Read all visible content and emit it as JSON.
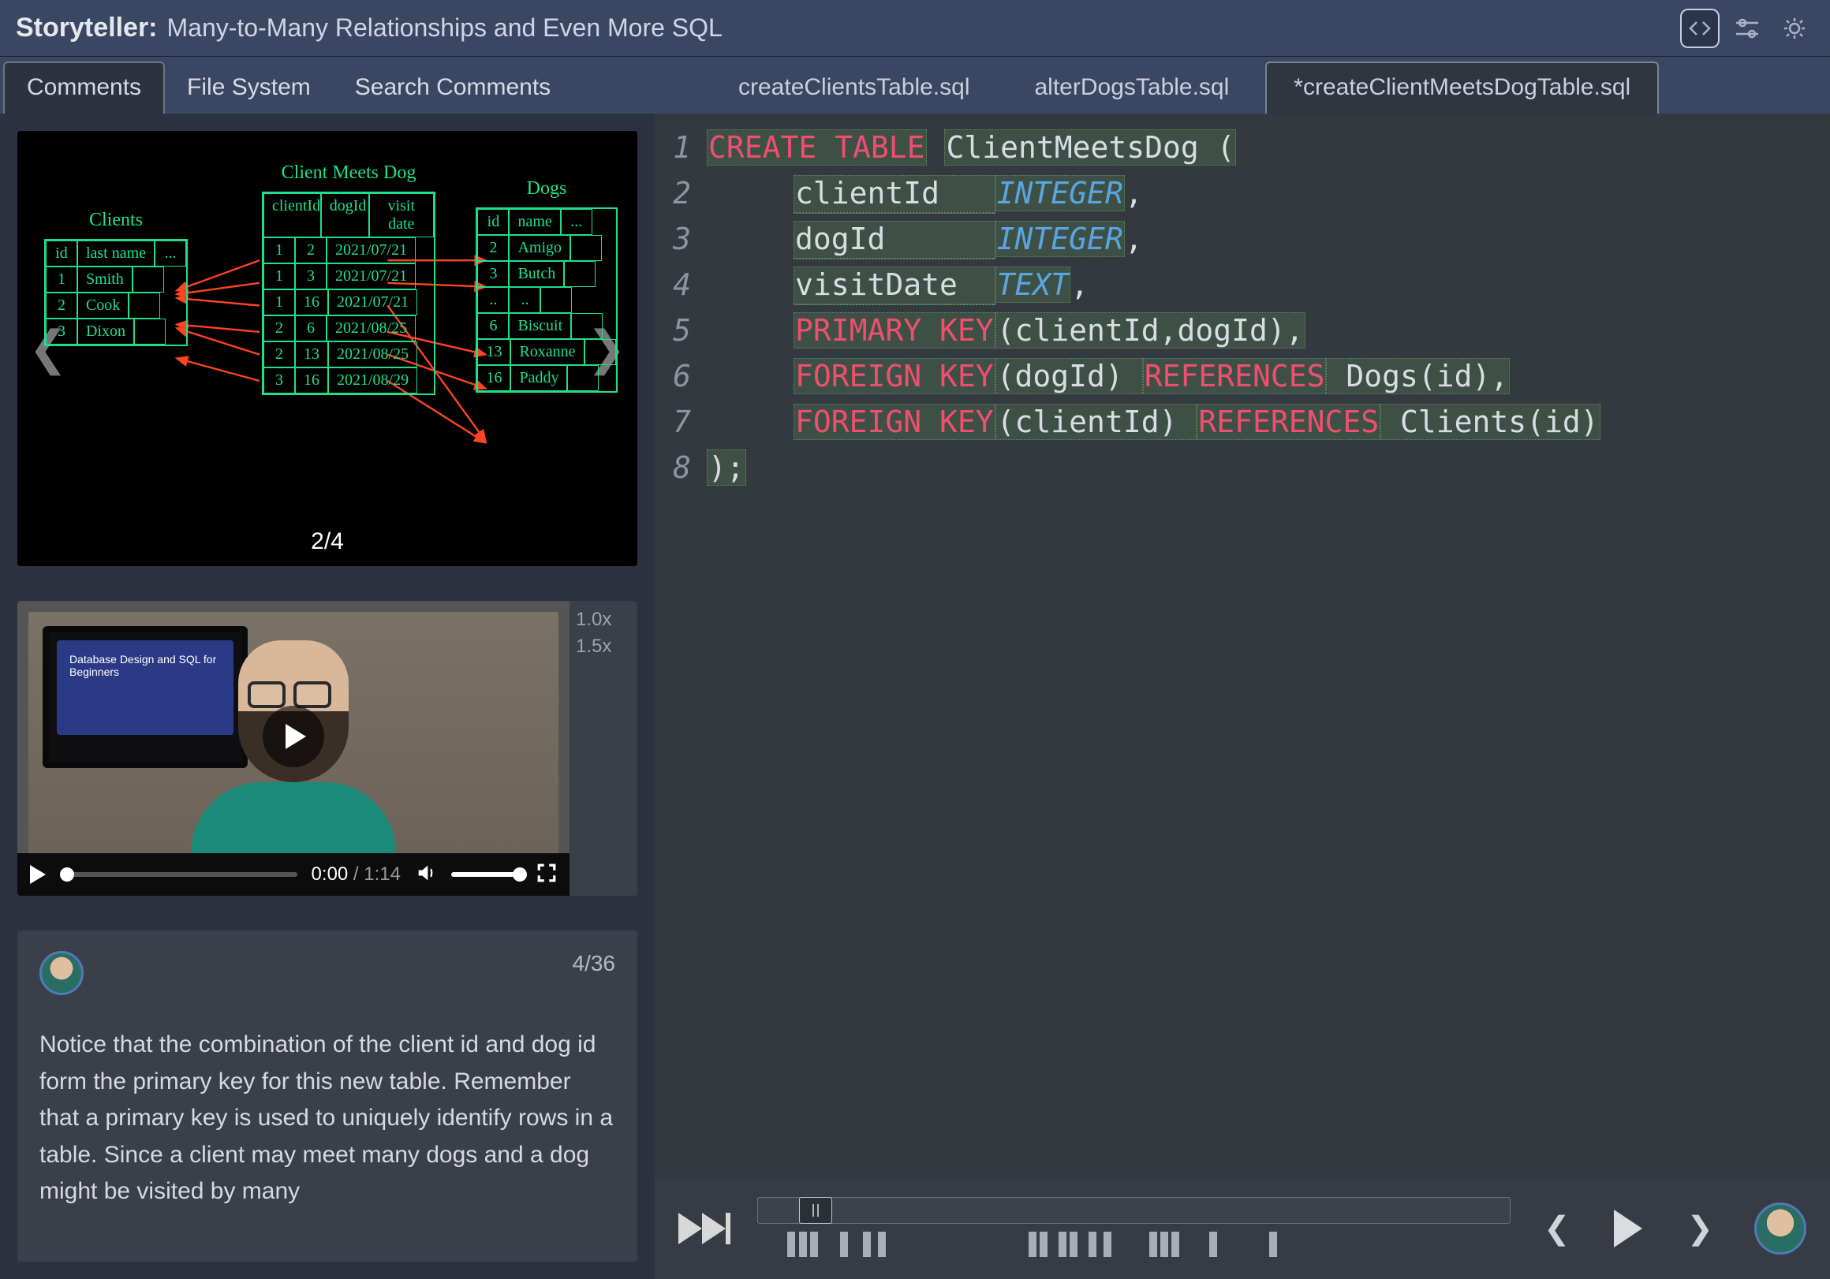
{
  "header": {
    "app_name": "Storyteller:",
    "title": "Many-to-Many Relationships and Even More SQL"
  },
  "panel_tabs": {
    "comments": "Comments",
    "filesystem": "File System",
    "search": "Search Comments",
    "active": "comments"
  },
  "diagram": {
    "page_indicator": "2/4",
    "tables": {
      "clients": {
        "name": "Clients",
        "header": [
          "id",
          "last name",
          "..."
        ],
        "rows": [
          [
            "1",
            "Smith",
            ""
          ],
          [
            "2",
            "Cook",
            ""
          ],
          [
            "3",
            "Dixon",
            ""
          ]
        ]
      },
      "junction": {
        "name": "Client Meets Dog",
        "header": [
          "clientId",
          "dogId",
          "visit date"
        ],
        "rows": [
          [
            "1",
            "2",
            "2021/07/21"
          ],
          [
            "1",
            "3",
            "2021/07/21"
          ],
          [
            "1",
            "16",
            "2021/07/21"
          ],
          [
            "2",
            "6",
            "2021/08/25"
          ],
          [
            "2",
            "13",
            "2021/08/25"
          ],
          [
            "3",
            "16",
            "2021/08/29"
          ]
        ]
      },
      "dogs": {
        "name": "Dogs",
        "header": [
          "id",
          "name",
          "..."
        ],
        "rows": [
          [
            "2",
            "Amigo",
            ""
          ],
          [
            "3",
            "Butch",
            ""
          ],
          [
            "..",
            "..",
            ""
          ],
          [
            "6",
            "Biscuit",
            ""
          ],
          [
            "13",
            "Roxanne",
            ""
          ],
          [
            "16",
            "Paddy",
            ""
          ]
        ]
      }
    }
  },
  "video": {
    "slide_title": "Database Design and SQL for Beginners",
    "current_time": "0:00",
    "duration": "1:14",
    "speeds": [
      "1.0x",
      "1.5x"
    ]
  },
  "comment": {
    "counter": "4/36",
    "body": "Notice that the combination of the client id and dog id form the primary key for this new table. Remember that a primary key is used to uniquely identify rows in a table. Since a client may meet many dogs and a dog might be visited by many"
  },
  "file_tabs": [
    {
      "label": "createClientsTable.sql",
      "active": false
    },
    {
      "label": "alterDogsTable.sql",
      "active": false
    },
    {
      "label": "*createClientMeetsDogTable.sql",
      "active": true
    }
  ],
  "code": {
    "lines": [
      "1",
      "2",
      "3",
      "4",
      "5",
      "6",
      "7",
      "8"
    ],
    "tokens": [
      [
        {
          "t": "CREATE TABLE",
          "c": "kw-red hl"
        },
        {
          "t": " "
        },
        {
          "t": "ClientMeetsDog (",
          "c": "ident hl"
        }
      ],
      [
        {
          "t": "",
          "c": "indent"
        },
        {
          "t": "clientId   ",
          "c": "ident hl dotline"
        },
        {
          "t": "INTEGER",
          "c": "kw-blue hl"
        },
        {
          "t": ",",
          "c": "ident"
        }
      ],
      [
        {
          "t": "",
          "c": "indent"
        },
        {
          "t": "dogId      ",
          "c": "ident hl dotline"
        },
        {
          "t": "INTEGER",
          "c": "kw-blue hl"
        },
        {
          "t": ",",
          "c": "ident"
        }
      ],
      [
        {
          "t": "",
          "c": "indent"
        },
        {
          "t": "visitDate  ",
          "c": "ident hl dotline"
        },
        {
          "t": "TEXT",
          "c": "kw-blue hl"
        },
        {
          "t": ",",
          "c": "ident"
        }
      ],
      [
        {
          "t": "",
          "c": "indent"
        },
        {
          "t": "PRIMARY KEY",
          "c": "kw-red hl"
        },
        {
          "t": "(clientId,dogId),",
          "c": "ident hl"
        }
      ],
      [
        {
          "t": "",
          "c": "indent"
        },
        {
          "t": "FOREIGN KEY",
          "c": "kw-red hl"
        },
        {
          "t": "(dogId) ",
          "c": "ident hl"
        },
        {
          "t": "REFERENCES",
          "c": "kw-red hl"
        },
        {
          "t": " Dogs(id),",
          "c": "ident hl"
        }
      ],
      [
        {
          "t": "",
          "c": "indent"
        },
        {
          "t": "FOREIGN KEY",
          "c": "kw-red hl"
        },
        {
          "t": "(clientId) ",
          "c": "ident hl"
        },
        {
          "t": "REFERENCES",
          "c": "kw-red hl"
        },
        {
          "t": " Clients(id)",
          "c": "ident hl"
        }
      ],
      [
        {
          "t": ");",
          "c": "ident hl"
        }
      ]
    ]
  },
  "marks_pct": [
    4,
    5.5,
    7,
    11,
    14,
    16,
    36,
    37.5,
    40,
    41.5,
    44,
    46,
    52,
    53.5,
    55,
    60,
    68
  ]
}
